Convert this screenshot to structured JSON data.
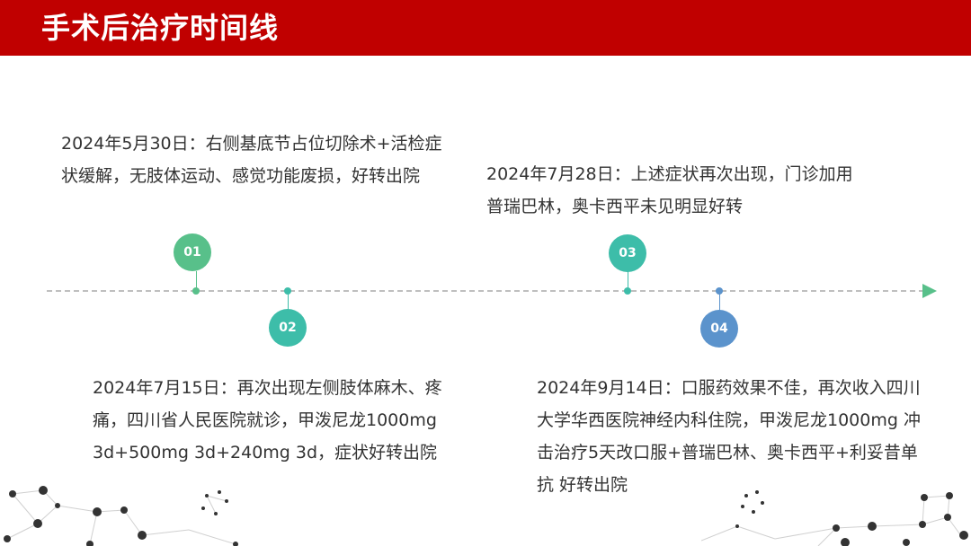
{
  "header": {
    "title": "手术后治疗时间线"
  },
  "colors": {
    "header": "#c00000",
    "green": "#58c08a",
    "teal": "#3dbda9",
    "blue": "#5b93cc"
  },
  "events": [
    {
      "badge": "01",
      "text": "2024年5月30日：右侧基底节占位切除术+活检症状缓解，无肢体运动、感觉功能废损，好转出院"
    },
    {
      "badge": "02",
      "text": "2024年7月15日：再次出现左侧肢体麻木、疼痛，四川省人民医院就诊，甲泼尼龙1000mg 3d+500mg 3d+240mg 3d，症状好转出院"
    },
    {
      "badge": "03",
      "text": "2024年7月28日：上述症状再次出现，门诊加用普瑞巴林，奥卡西平未见明显好转"
    },
    {
      "badge": "04",
      "text": "2024年9月14日：口服药效果不佳，再次收入四川大学华西医院神经内科住院，甲泼尼龙1000mg 冲击治疗5天改口服+普瑞巴林、奥卡西平+利妥昔单抗 好转出院"
    }
  ]
}
